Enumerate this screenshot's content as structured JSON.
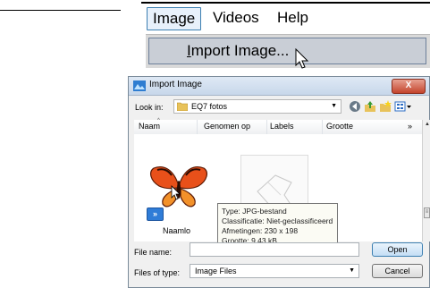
{
  "menubar": {
    "image": "Image",
    "videos": "Videos",
    "help": "Help"
  },
  "dropdown": {
    "import_image": "Import Image..."
  },
  "dialog": {
    "title": "Import Image",
    "close_label": "X",
    "look_in_label": "Look in:",
    "look_in_value": "EQ7 fotos",
    "columns": [
      "Naam",
      "Genomen op",
      "Labels",
      "Grootte"
    ],
    "more_columns": "»",
    "file_label": "Naamlo",
    "tooltip": {
      "type": "Type: JPG-bestand",
      "classification": "Classificatie: Niet-geclassificeerd",
      "dimensions": "Afmetingen: 230 x 198",
      "size": "Grootte: 9,43 kB"
    },
    "file_name_label": "File name:",
    "file_name_value": "",
    "files_of_type_label": "Files of type:",
    "files_of_type_value": "Image Files",
    "open_button": "Open",
    "cancel_button": "Cancel"
  }
}
